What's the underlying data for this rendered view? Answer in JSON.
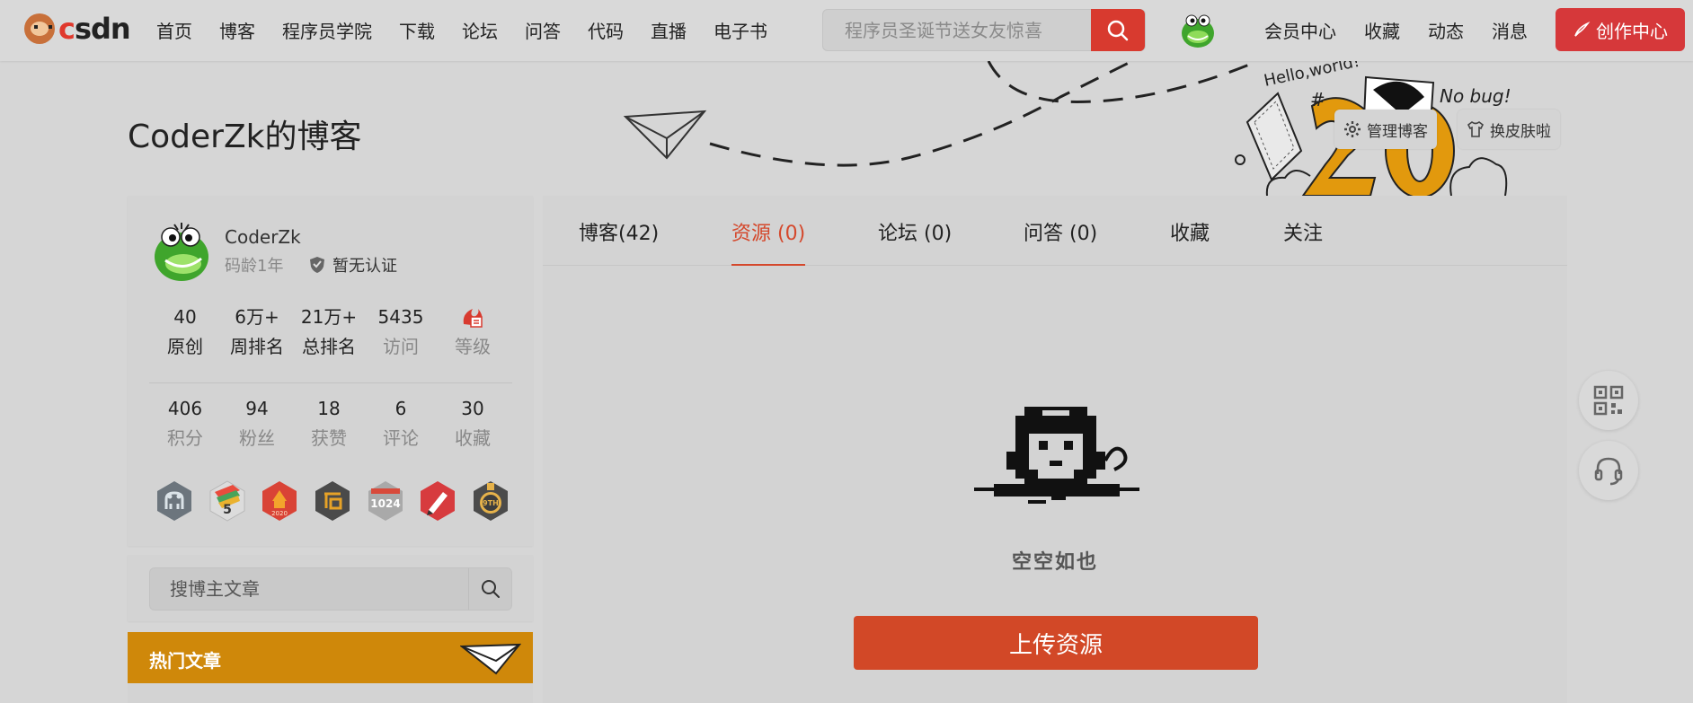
{
  "topbar": {
    "brand": "CSDN",
    "nav": [
      "首页",
      "博客",
      "程序员学院",
      "下载",
      "论坛",
      "问答",
      "代码",
      "直播",
      "电子书"
    ],
    "search_placeholder": "程序员圣诞节送女友惊喜",
    "right_nav": [
      "会员中心",
      "收藏",
      "动态",
      "消息"
    ],
    "create_label": "创作中心",
    "accent": "#d6383a"
  },
  "banner": {
    "blog_title": "CoderZk的博客",
    "manage_label": "管理博客",
    "skin_label": "换皮肤啦",
    "art_text_1": "Hello,world!",
    "art_text_2": "No bug!",
    "art_text_3": "#"
  },
  "profile": {
    "name": "CoderZk",
    "code_age": "码龄1年",
    "cert": "暂无认证",
    "stats_row1": [
      {
        "value": "40",
        "label": "原创"
      },
      {
        "value": "6万+",
        "label": "周排名"
      },
      {
        "value": "21万+",
        "label": "总排名"
      },
      {
        "value": "5435",
        "label": "访问"
      },
      {
        "value": "",
        "label": "等级"
      }
    ],
    "stats_row2": [
      {
        "value": "406",
        "label": "积分"
      },
      {
        "value": "94",
        "label": "粉丝"
      },
      {
        "value": "18",
        "label": "获赞"
      },
      {
        "value": "6",
        "label": "评论"
      },
      {
        "value": "30",
        "label": "收藏"
      }
    ],
    "badge_texts": {
      "b2": "5",
      "b3": "2020",
      "b5": "1024",
      "b7": "9TH"
    }
  },
  "sidebar": {
    "search_placeholder": "搜博主文章",
    "hot_title": "热门文章"
  },
  "main": {
    "tabs": [
      "博客(42)",
      "资源 (0)",
      "论坛 (0)",
      "问答 (0)",
      "收藏",
      "关注"
    ],
    "active_tab_index": 1,
    "empty_text": "空空如也",
    "upload_label": "上传资源",
    "accent": "#d24827"
  }
}
